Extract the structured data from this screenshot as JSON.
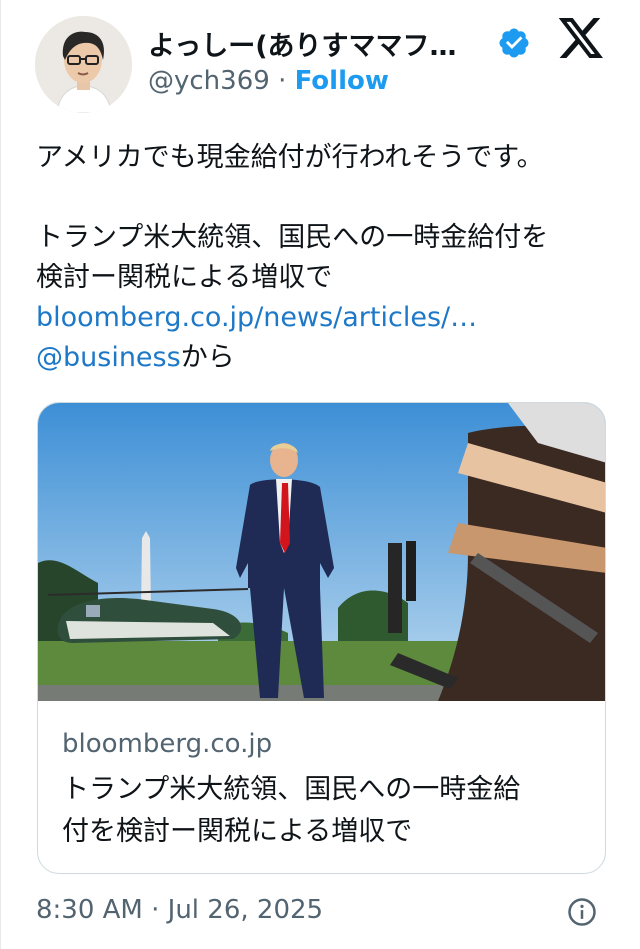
{
  "author": {
    "display_name": "よっしー(ありすママフ…",
    "handle": "@ych369",
    "separator": "·",
    "follow_label": "Follow"
  },
  "icons": {
    "verified": "verified-badge-icon",
    "brand": "x-logo-icon",
    "info": "info-icon"
  },
  "colors": {
    "accent": "#1d9bf0",
    "link": "#1d78c8",
    "muted": "#536471",
    "text": "#0f1419",
    "border": "#cfd9de"
  },
  "tweet": {
    "line1": "アメリカでも現金給付が行われそうです。",
    "line2": "トランプ米大統領、国民への一時金給付を",
    "line3": "検討ー関税による増収で",
    "link_text": "bloomberg.co.jp/news/articles/…",
    "mention": "@business",
    "mention_suffix": "から"
  },
  "card": {
    "domain": "bloomberg.co.jp",
    "title_line1": "トランプ米大統領、国民への一時金給",
    "title_line2": "付を検討ー関税による増収で"
  },
  "timestamp": "8:30 AM · Jul 26, 2025"
}
